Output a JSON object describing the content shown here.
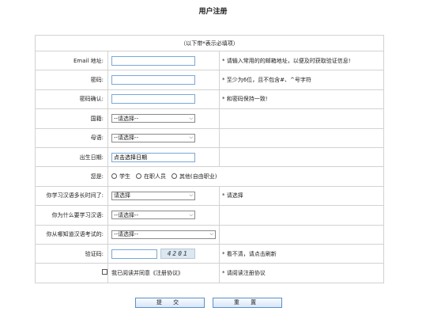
{
  "page": {
    "title": "用户注册"
  },
  "form": {
    "notice": "（以下带*表示必填项）",
    "email": {
      "label": "Email 地址:",
      "value": "",
      "hint": "* 请输入常用的的邮箱地址，以便及时获取验证信息!"
    },
    "password": {
      "label": "密码:",
      "value": "",
      "hint": "* 至少为6位，且不包含#、^号字符"
    },
    "password_confirm": {
      "label": "密码确认:",
      "value": "",
      "hint": "* 和密码保持一致!"
    },
    "nationality": {
      "label": "国籍:",
      "selected": "--请选择--"
    },
    "mother_tongue": {
      "label": "母语:",
      "selected": "--请选择--"
    },
    "birthdate": {
      "label": "出生日期:",
      "value": "点击选择日期"
    },
    "identity": {
      "label": "您是:",
      "options": [
        "学生",
        "在职人员",
        "其他(自由职业)"
      ]
    },
    "study_duration": {
      "label": "你学习汉语多长时间了:",
      "selected": "请选择",
      "hint": "* 请选择"
    },
    "study_reason": {
      "label": "你为什么要学习汉语:",
      "selected": "--请选择--"
    },
    "exam_source": {
      "label": "你从哪知道汉语考试的:",
      "selected": "--请选择--"
    },
    "captcha": {
      "label": "验证码:",
      "value": "",
      "image_text": "4201",
      "hint": "* 看不清，请点击刷新"
    },
    "agreement": {
      "text": "我已阅读并同意《注册协议》",
      "hint": "* 请阅读注册协议"
    }
  },
  "buttons": {
    "submit": "提 交",
    "reset": "重 置"
  },
  "colors": {
    "input_border": "#7aa7d8",
    "button_border": "#5b8fc9",
    "table_border": "#d2d2d2"
  }
}
